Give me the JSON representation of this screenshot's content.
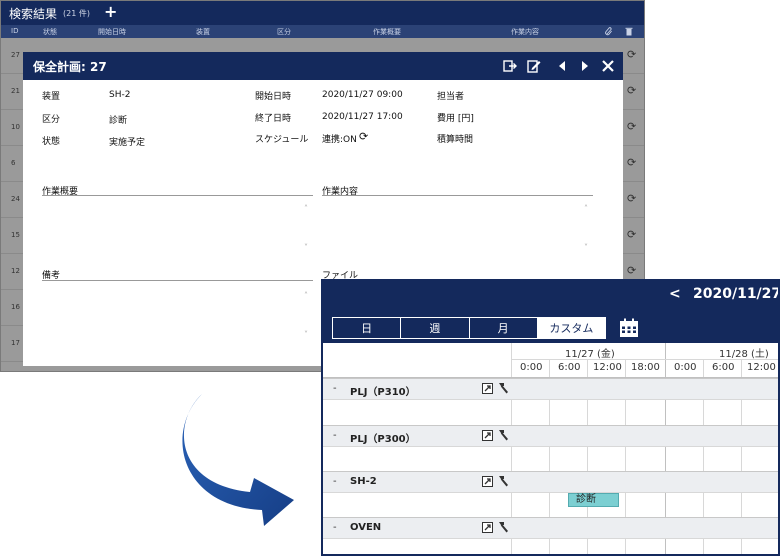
{
  "list": {
    "title": "検索結果",
    "count": "(21 件)",
    "add": "+",
    "columns": [
      "ID",
      "状態",
      "開始日時",
      "装置",
      "区分",
      "作業概要",
      "作業内容"
    ],
    "row_ids": [
      "27",
      "21",
      "10",
      "6",
      "24",
      "15",
      "12",
      "16",
      "17"
    ]
  },
  "modal": {
    "title": "保全計画: 27",
    "fields": {
      "device_label": "装置",
      "device_value": "SH-2",
      "category_label": "区分",
      "category_value": "診断",
      "status_label": "状態",
      "status_value": "実施予定",
      "start_label": "開始日時",
      "start_value": "2020/11/27 09:00",
      "end_label": "終了日時",
      "end_value": "2020/11/27 17:00",
      "schedule_label": "スケジュール",
      "schedule_value": "連携:ON",
      "person_label": "担当者",
      "cost_label": "費用 [円]",
      "time_label": "積算時間"
    },
    "sections": {
      "summary": "作業概要",
      "content": "作業内容",
      "notes": "備考",
      "files": "ファイル"
    }
  },
  "calendar": {
    "prev": "<",
    "date": "2020/11/27",
    "tabs": [
      "日",
      "週",
      "月",
      "カスタム"
    ],
    "active_tab": 3,
    "days": [
      "11/27 (金)",
      "11/28 (土)"
    ],
    "hours": [
      "0:00",
      "6:00",
      "12:00",
      "18:00",
      "0:00",
      "6:00",
      "12:00"
    ],
    "groups": [
      "PLJ（P310）",
      "PLJ（P300）",
      "SH-2",
      "OVEN"
    ],
    "event": {
      "label": "診断",
      "group": "SH-2",
      "start": "2020/11/27 09:00",
      "end": "2020/11/27 17:00"
    },
    "colors": {
      "navy": "#14295c",
      "event": "#7ccfd2"
    }
  }
}
